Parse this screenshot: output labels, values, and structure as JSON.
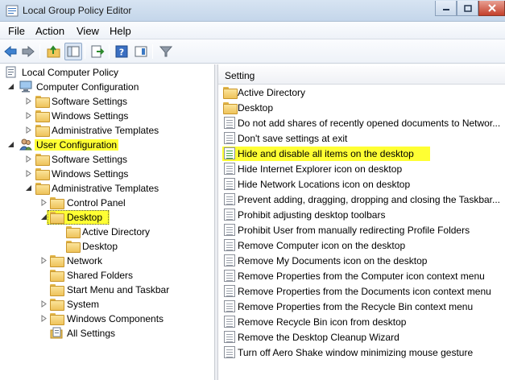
{
  "window": {
    "title": "Local Group Policy Editor"
  },
  "menu": [
    "File",
    "Action",
    "View",
    "Help"
  ],
  "toolbar": {
    "buttons": [
      "back-arrow-icon",
      "forward-arrow-icon",
      "up-folder-icon",
      "show-hide-console-tree-icon",
      "export-list-icon",
      "help-icon",
      "toggle-pane-icon",
      "filter-icon"
    ]
  },
  "tree": {
    "root": "Local Computer Policy",
    "computer_configuration": "Computer Configuration",
    "cc_software_settings": "Software Settings",
    "cc_windows_settings": "Windows Settings",
    "cc_administrative_templates": "Administrative Templates",
    "user_configuration": "User Configuration",
    "uc_software_settings": "Software Settings",
    "uc_windows_settings": "Windows Settings",
    "uc_administrative_templates": "Administrative Templates",
    "control_panel": "Control Panel",
    "desktop": "Desktop",
    "active_directory": "Active Directory",
    "desktop_sub": "Desktop",
    "network": "Network",
    "shared_folders": "Shared Folders",
    "start_menu_taskbar": "Start Menu and Taskbar",
    "system": "System",
    "windows_components": "Windows Components",
    "all_settings": "All Settings"
  },
  "list": {
    "column_header": "Setting",
    "items": [
      "Active Directory",
      "Desktop",
      "Do not add shares of recently opened documents to Networ...",
      "Don't save settings at exit",
      "Hide and disable all items on the desktop",
      "Hide Internet Explorer icon on desktop",
      "Hide Network Locations icon on desktop",
      "Prevent adding, dragging, dropping and closing the Taskbar...",
      "Prohibit adjusting desktop toolbars",
      "Prohibit User from manually redirecting Profile Folders",
      "Remove Computer icon on the desktop",
      "Remove My Documents icon on the desktop",
      "Remove Properties from the Computer icon context menu",
      "Remove Properties from the Documents icon context menu",
      "Remove Properties from the Recycle Bin context menu",
      "Remove Recycle Bin icon from desktop",
      "Remove the Desktop Cleanup Wizard",
      "Turn off Aero Shake window minimizing mouse gesture"
    ]
  },
  "colors": {
    "highlight": "#ffff33",
    "titlebar": "#c4d6ea"
  }
}
